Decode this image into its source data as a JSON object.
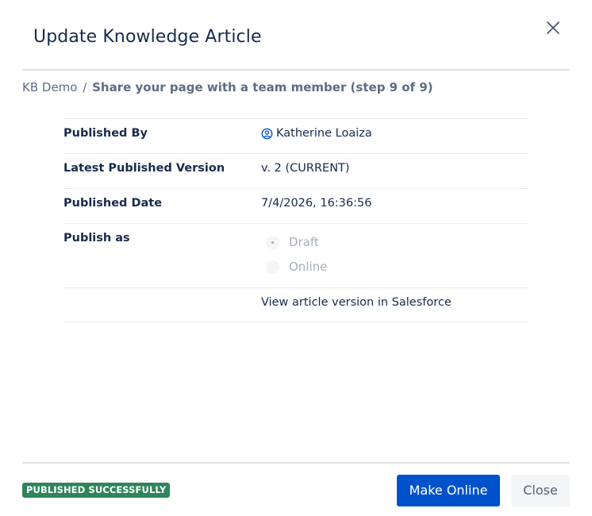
{
  "modal": {
    "title": "Update Knowledge Article",
    "close_icon": "close-icon"
  },
  "breadcrumb": {
    "root": "KB Demo",
    "separator": "/",
    "current": "Share your page with a team member (step 9 of 9)"
  },
  "details": {
    "published_by": {
      "label": "Published By",
      "value": "Katherine Loaiza",
      "icon": "user-circle-icon"
    },
    "latest_version": {
      "label": "Latest Published Version",
      "value": "v. 2 (CURRENT)"
    },
    "published_date": {
      "label": "Published Date",
      "value": "7/4/2026, 16:36:56"
    },
    "publish_as": {
      "label": "Publish as",
      "options": [
        {
          "label": "Draft",
          "checked": true,
          "disabled": true
        },
        {
          "label": "Online",
          "checked": false,
          "disabled": true
        }
      ]
    },
    "salesforce_link": "View article version in Salesforce"
  },
  "footer": {
    "status_badge": "PUBLISHED SUCCESSFULLY",
    "primary_button": "Make Online",
    "close_button": "Close"
  },
  "colors": {
    "primary": "#0052cc",
    "success": "#2f8559",
    "text": "#172b4d",
    "muted": "#a5adba"
  }
}
